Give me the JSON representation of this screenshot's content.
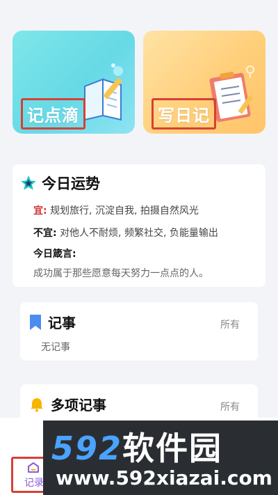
{
  "cards": {
    "jot": {
      "title": "记点滴"
    },
    "diary": {
      "title": "写日记"
    }
  },
  "fortune": {
    "title": "今日运势",
    "good_label": "宜:",
    "good_text": "规划旅行, 沉淀自我, 拍摄自然风光",
    "bad_label": "不宜:",
    "bad_text": "对他人不耐烦, 频繁社交, 负能量输出",
    "motto_label": "今日箴言:",
    "motto_text": "成功属于那些愿意每天努力一点点的人。"
  },
  "memo": {
    "title": "记事",
    "more": "所有",
    "empty": "无记事"
  },
  "multi_memo": {
    "title": "多项记事",
    "more": "所有"
  },
  "tabbar": {
    "record_label": "记录"
  },
  "watermark": {
    "number": "592",
    "brand": "软件园",
    "url": "www.592xiazai.com"
  },
  "colors": {
    "jot_card": "#67d9e6",
    "diary_card": "#ffcf7a",
    "highlight_box": "#d64035",
    "good_label": "#d32f2f",
    "accent_purple": "#8a5cd6"
  }
}
